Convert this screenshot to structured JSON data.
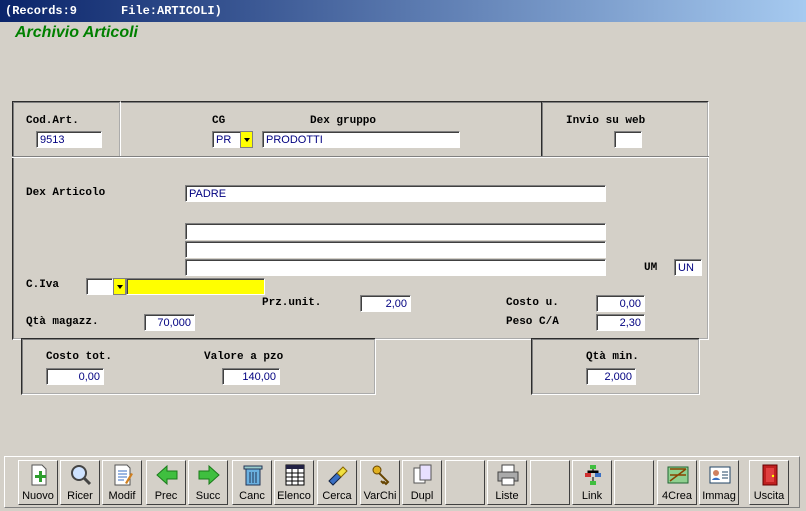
{
  "titlebar": {
    "records": "(Records:9",
    "file": "File:ARTICOLI)"
  },
  "app_title": "Archivio Articoli",
  "fields": {
    "cod_art": {
      "label": "Cod.Art.",
      "value": "9513"
    },
    "cg": {
      "label": "CG",
      "value": "PR"
    },
    "dex_gruppo": {
      "label": "Dex gruppo",
      "value": "PRODOTTI"
    },
    "invio_web": {
      "label": "Invio su web",
      "value": ""
    },
    "dex_articolo": {
      "label": "Dex Articolo",
      "value": "PADRE",
      "extra_lines": [
        "",
        "",
        ""
      ]
    },
    "um": {
      "label": "UM",
      "value": "UN"
    },
    "c_iva": {
      "label": "C.Iva",
      "code": "",
      "description": ""
    },
    "prz_unit": {
      "label": "Prz.unit.",
      "value": "2,00"
    },
    "costo_u": {
      "label": "Costo u.",
      "value": "0,00"
    },
    "qta_magazz": {
      "label": "Qtà magazz.",
      "value": "70,000"
    },
    "peso_ca": {
      "label": "Peso C/A",
      "value": "2,30"
    },
    "costo_tot": {
      "label": "Costo tot.",
      "value": "0,00"
    },
    "valore_pzo": {
      "label": "Valore a pzo",
      "value": "140,00"
    },
    "qta_min": {
      "label": "Qtà min.",
      "value": "2,000"
    }
  },
  "colors": {
    "title_green": "#008000",
    "field_text": "#000080",
    "iva_highlight": "#ffff00"
  },
  "toolbar": [
    {
      "label": "Nuovo",
      "icon": "new-doc-icon"
    },
    {
      "label": "Ricer",
      "icon": "magnifier-icon"
    },
    {
      "label": "Modif",
      "icon": "edit-doc-icon"
    },
    {
      "label": "Prec",
      "icon": "arrow-left-icon"
    },
    {
      "label": "Succ",
      "icon": "arrow-right-icon"
    },
    {
      "label": "Canc",
      "icon": "trash-icon"
    },
    {
      "label": "Elenco",
      "icon": "table-icon"
    },
    {
      "label": "Cerca",
      "icon": "flashlight-icon"
    },
    {
      "label": "VarChi",
      "icon": "keys-icon"
    },
    {
      "label": "Dupl",
      "icon": "duplicate-icon"
    },
    {
      "label": "",
      "icon": "blank"
    },
    {
      "label": "Liste",
      "icon": "printer-icon"
    },
    {
      "label": "",
      "icon": "blank"
    },
    {
      "label": "Link",
      "icon": "tree-icon"
    },
    {
      "label": "",
      "icon": "blank"
    },
    {
      "label": "4Crea",
      "icon": "build-icon"
    },
    {
      "label": "Immag",
      "icon": "id-card-icon"
    },
    {
      "label": "Uscita",
      "icon": "exit-door-icon"
    }
  ]
}
